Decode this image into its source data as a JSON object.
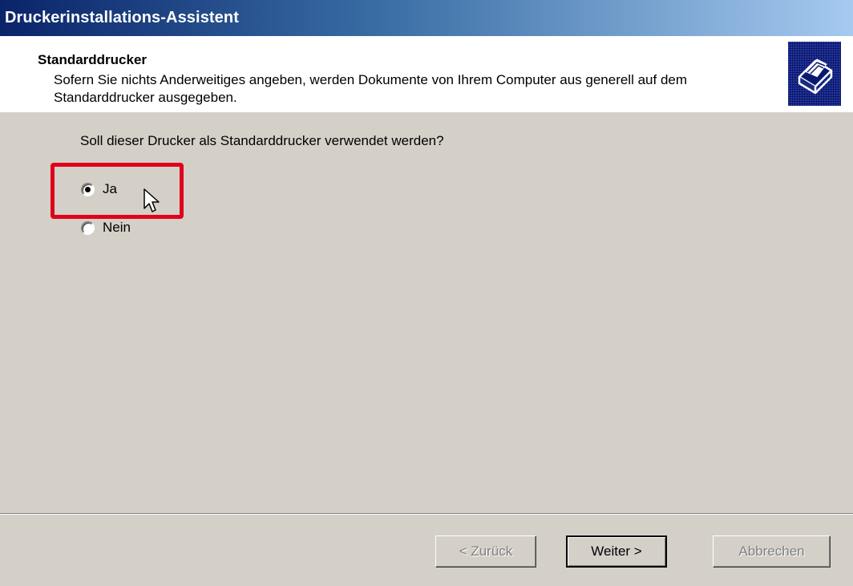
{
  "window": {
    "title": "Druckerinstallations-Assistent"
  },
  "header": {
    "title": "Standarddrucker",
    "description": "Sofern Sie nichts Anderweitiges angeben, werden Dokumente von Ihrem Computer aus generell auf dem Standarddrucker ausgegeben.",
    "icon": "printer-icon"
  },
  "main": {
    "question": "Soll dieser Drucker als Standarddrucker verwendet werden?",
    "options": [
      {
        "label": "Ja",
        "selected": true
      },
      {
        "label": "Nein",
        "selected": false
      }
    ],
    "highlight_color": "#e0001b"
  },
  "buttons": {
    "back": "< Zurück",
    "next": "Weiter >",
    "cancel": "Abbrechen"
  },
  "colors": {
    "title_gradient_start": "#0a246a",
    "title_gradient_end": "#a6caf0",
    "dialog_background": "#d4d0c8"
  }
}
